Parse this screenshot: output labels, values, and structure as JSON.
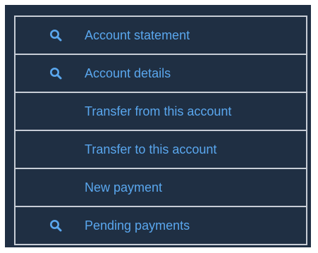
{
  "menu": {
    "items": [
      {
        "label": "Account statement",
        "icon": "search-icon"
      },
      {
        "label": "Account details",
        "icon": "search-icon"
      },
      {
        "label": "Transfer from this account",
        "icon": ""
      },
      {
        "label": "Transfer to this account",
        "icon": ""
      },
      {
        "label": "New payment",
        "icon": ""
      },
      {
        "label": "Pending payments",
        "icon": "search-icon"
      }
    ]
  },
  "colors": {
    "background": "#1f2f43",
    "border": "#c7cdd6",
    "link": "#5aa7ee"
  }
}
